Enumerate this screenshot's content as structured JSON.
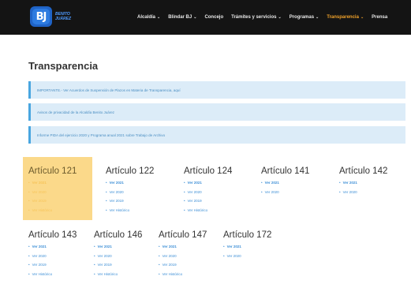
{
  "brand": {
    "initials": "BJ",
    "line1": "BENITO",
    "line2": "JUÁREZ"
  },
  "nav": [
    {
      "label": "Alcaldía",
      "chevron": true,
      "active": false
    },
    {
      "label": "Blindar BJ",
      "chevron": true,
      "active": false
    },
    {
      "label": "Concejo",
      "chevron": false,
      "active": false
    },
    {
      "label": "Trámites y servicios",
      "chevron": true,
      "active": false
    },
    {
      "label": "Programas",
      "chevron": true,
      "active": false
    },
    {
      "label": "Transparencia",
      "chevron": true,
      "active": true
    },
    {
      "label": "Prensa",
      "chevron": false,
      "active": false
    }
  ],
  "page_title": "Transparencia",
  "notices": [
    "IMPORTANTE.- Ver Acuerdos de Suspensión de Plazos en Materia de Transparencia, aquí",
    "Avisos de privacidad de la Alcaldía Benito Juárez",
    "Informe PIDA del ejercicio 2020 y Programa anual 2021 sobre Trabajo de Archivo"
  ],
  "articles": [
    {
      "title": "Artículo 121",
      "links": [
        "Ver 2021",
        "Ver 2020",
        "Ver 2019",
        "Ver Histórico"
      ],
      "highlight": true
    },
    {
      "title": "Artículo 122",
      "links": [
        "Ver 2021",
        "Ver 2020",
        "Ver 2019",
        "Ver Histórico"
      ]
    },
    {
      "title": "Artículo 124",
      "links": [
        "Ver 2021",
        "Ver 2020",
        "Ver 2019",
        "Ver Histórico"
      ]
    },
    {
      "title": "Artículo 141",
      "links": [
        "Ver 2021",
        "Ver 2020"
      ]
    },
    {
      "title": "Artículo 142",
      "links": [
        "Ver 2021",
        "Ver 2020"
      ]
    },
    {
      "title": "Artículo 143",
      "links": [
        "Ver 2021",
        "Ver 2020",
        "Ver 2019",
        "Ver Histórico"
      ]
    },
    {
      "title": "Artículo 146",
      "links": [
        "Ver 2021",
        "Ver 2020",
        "Ver 2019",
        "Ver Histórico"
      ]
    },
    {
      "title": "Artículo 147",
      "links": [
        "Ver 2021",
        "Ver 2020",
        "Ver 2019",
        "Ver Histórico"
      ]
    },
    {
      "title": "Artículo 172",
      "links": [
        "Ver 2021",
        "Ver 2020"
      ]
    }
  ]
}
